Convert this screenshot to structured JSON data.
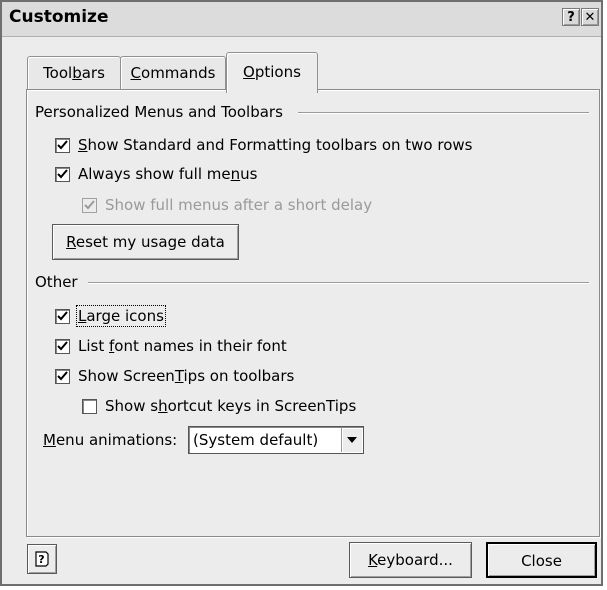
{
  "window": {
    "title": "Customize",
    "help_glyph": "?",
    "close_glyph": "✕"
  },
  "tabs": [
    {
      "label": "Toolbars",
      "underline": "b"
    },
    {
      "label": "Commands",
      "underline": "C"
    },
    {
      "label": "Options",
      "underline": "O",
      "active": true
    }
  ],
  "personalized": {
    "group_label": "Personalized Menus and Toolbars",
    "show_two_rows": {
      "label": "Show Standard and Formatting toolbars on two rows",
      "checked": true
    },
    "always_full_menus": {
      "label": "Always show full menus",
      "checked": true
    },
    "full_menus_delay": {
      "label": "Show full menus after a short delay",
      "checked": true,
      "disabled": true
    },
    "reset_button": "Reset my usage data"
  },
  "other": {
    "group_label": "Other",
    "large_icons": {
      "label": "Large icons",
      "checked": true
    },
    "list_font_names": {
      "label": "List font names in their font",
      "checked": true
    },
    "show_screentips": {
      "label": "Show ScreenTips on toolbars",
      "checked": true
    },
    "show_shortcut_keys": {
      "label": "Show shortcut keys in ScreenTips",
      "checked": false
    },
    "menu_animations_label": "Menu animations:",
    "menu_animations_value": "(System default)"
  },
  "footer": {
    "help_icon_glyph": "?",
    "keyboard_button": "Keyboard...",
    "close_button": "Close"
  },
  "icons": {
    "check": "checkmark-icon",
    "dropdown": "chevron-down-icon",
    "help": "help-icon",
    "close": "close-icon"
  }
}
